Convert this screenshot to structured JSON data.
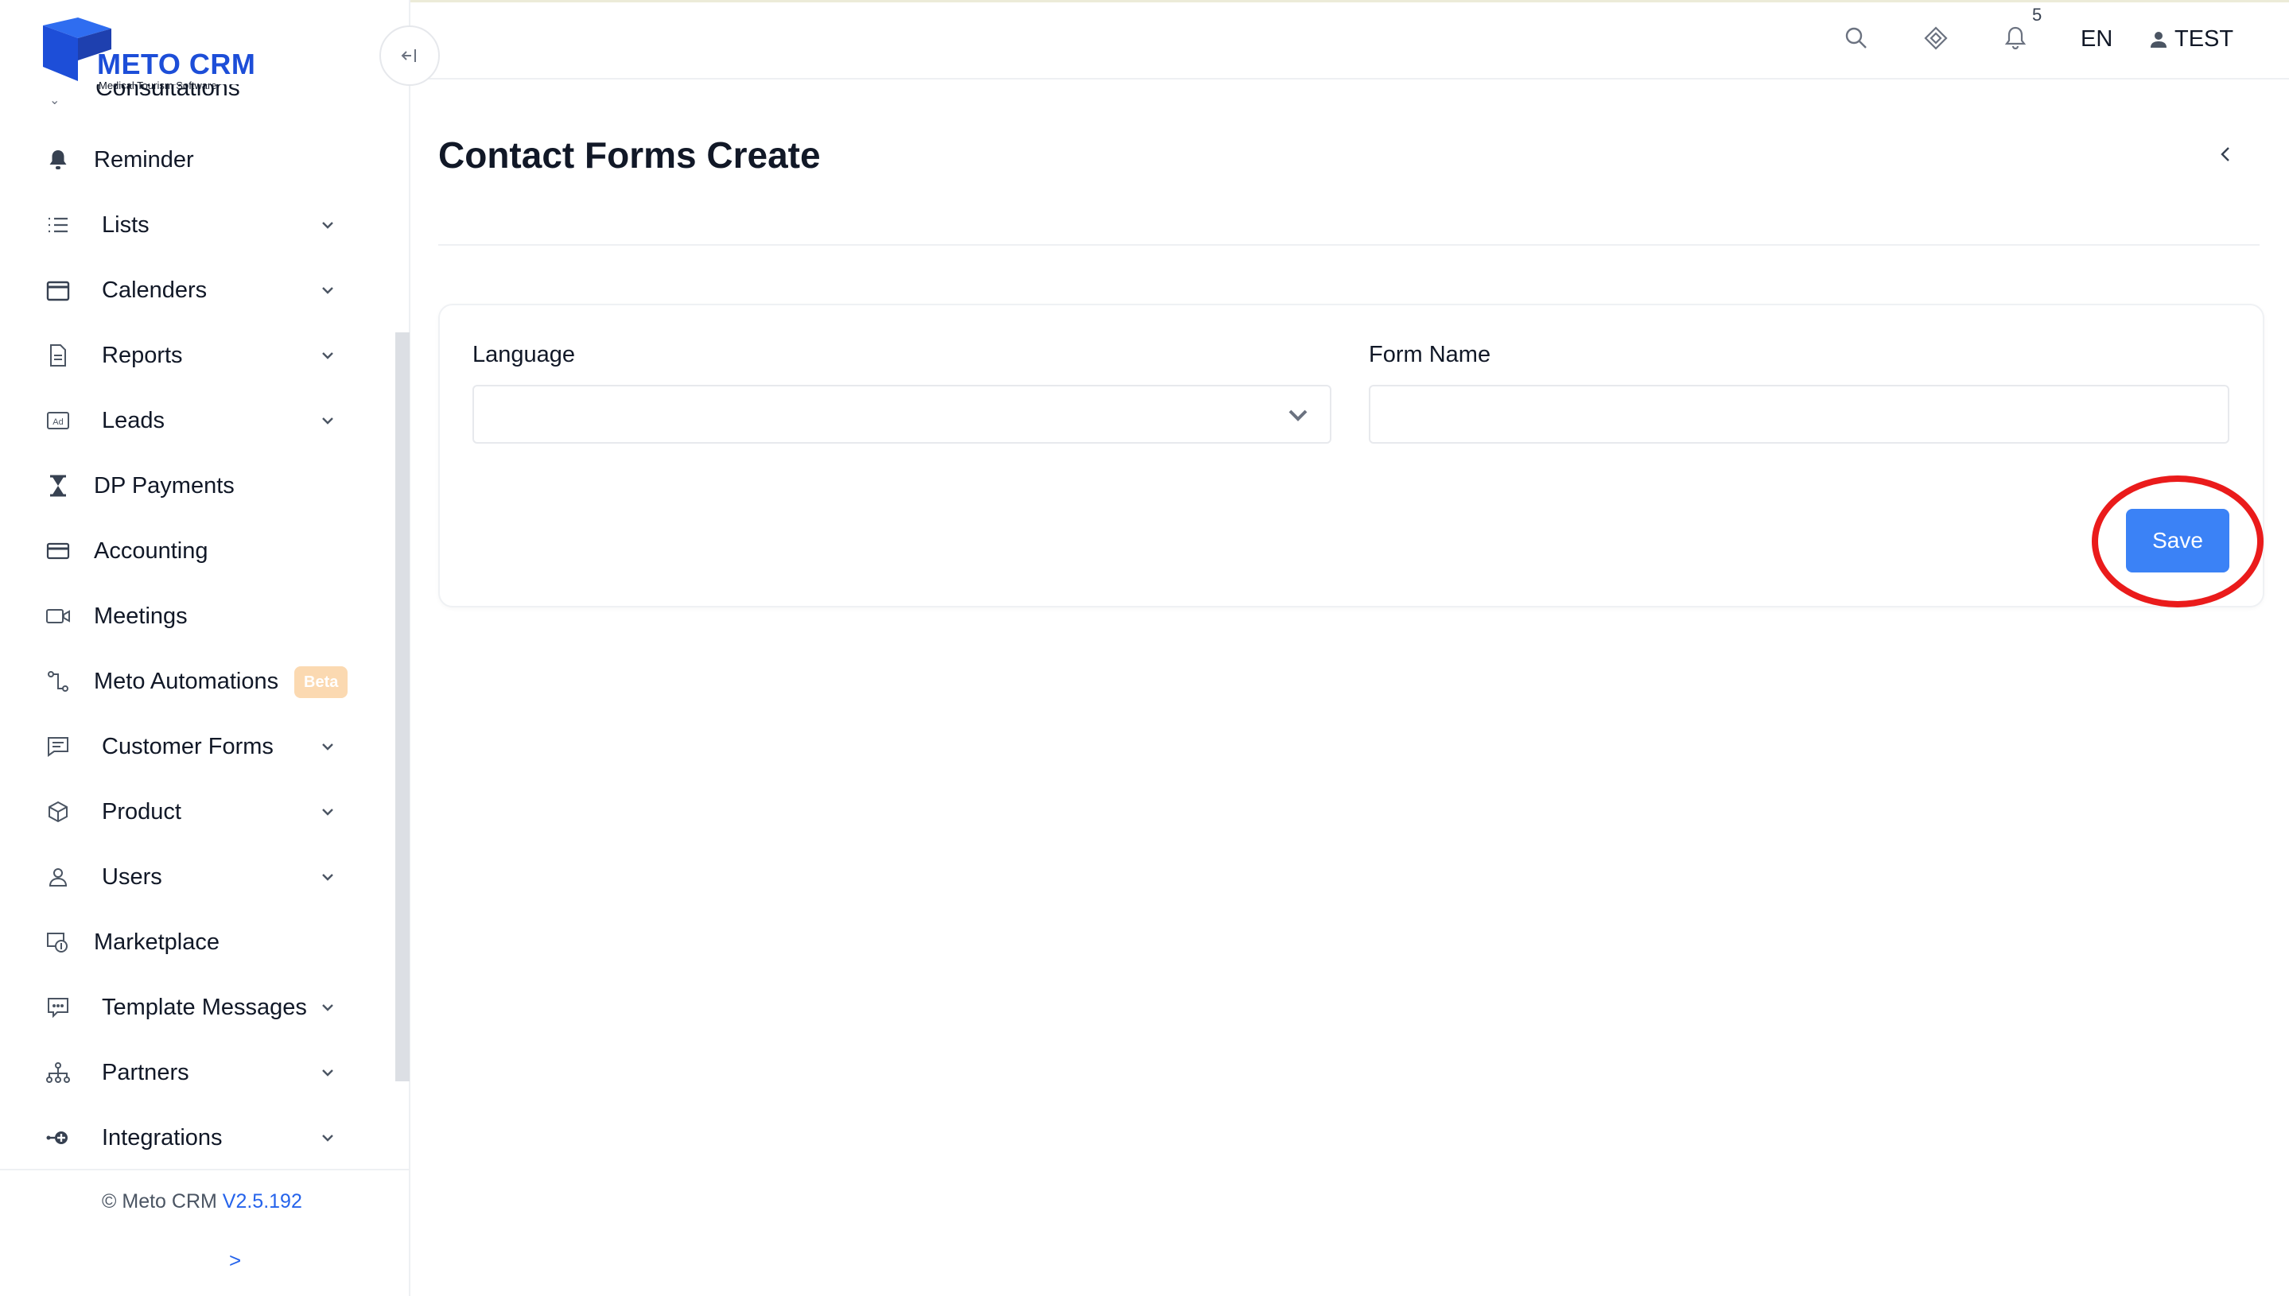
{
  "brand": {
    "name": "METO CRM",
    "tagline": "Medical Tourism Software",
    "accent": "#1d4ed8"
  },
  "sidebar": {
    "partial_item": "Consultations",
    "items": [
      {
        "label": "Reminder",
        "icon": "bell-icon",
        "has_submenu": false
      },
      {
        "label": "Lists",
        "icon": "list-icon",
        "has_submenu": true
      },
      {
        "label": "Calenders",
        "icon": "calendar-icon",
        "has_submenu": true
      },
      {
        "label": "Reports",
        "icon": "document-icon",
        "has_submenu": true
      },
      {
        "label": "Leads",
        "icon": "ad-icon",
        "has_submenu": true
      },
      {
        "label": "DP Payments",
        "icon": "hourglass-icon",
        "has_submenu": false
      },
      {
        "label": "Accounting",
        "icon": "credit-card-icon",
        "has_submenu": false
      },
      {
        "label": "Meetings",
        "icon": "video-camera-icon",
        "has_submenu": false
      },
      {
        "label": "Meto Automations",
        "icon": "workflow-icon",
        "has_submenu": false,
        "badge": "Beta"
      },
      {
        "label": "Customer Forms",
        "icon": "chat-form-icon",
        "has_submenu": true
      },
      {
        "label": "Product",
        "icon": "box-icon",
        "has_submenu": true
      },
      {
        "label": "Users",
        "icon": "user-icon",
        "has_submenu": true
      },
      {
        "label": "Marketplace",
        "icon": "store-icon",
        "has_submenu": false
      },
      {
        "label": "Template Messages",
        "icon": "message-template-icon",
        "has_submenu": true
      },
      {
        "label": "Partners",
        "icon": "network-icon",
        "has_submenu": true
      },
      {
        "label": "Integrations",
        "icon": "plug-icon",
        "has_submenu": true
      }
    ],
    "footer": {
      "copyright": "© Meto CRM",
      "version": "V2.5.192",
      "expand_label": ">"
    }
  },
  "header": {
    "notification_count": "5",
    "language": "EN",
    "user": "TEST"
  },
  "page": {
    "title": "Contact Forms Create",
    "form": {
      "language_label": "Language",
      "language_value": "",
      "form_name_label": "Form Name",
      "form_name_value": "",
      "save_label": "Save"
    }
  },
  "colors": {
    "primary_button": "#3b82f6",
    "highlight_ring": "#ea1b1b",
    "beta_badge": "#fbd9b1"
  }
}
